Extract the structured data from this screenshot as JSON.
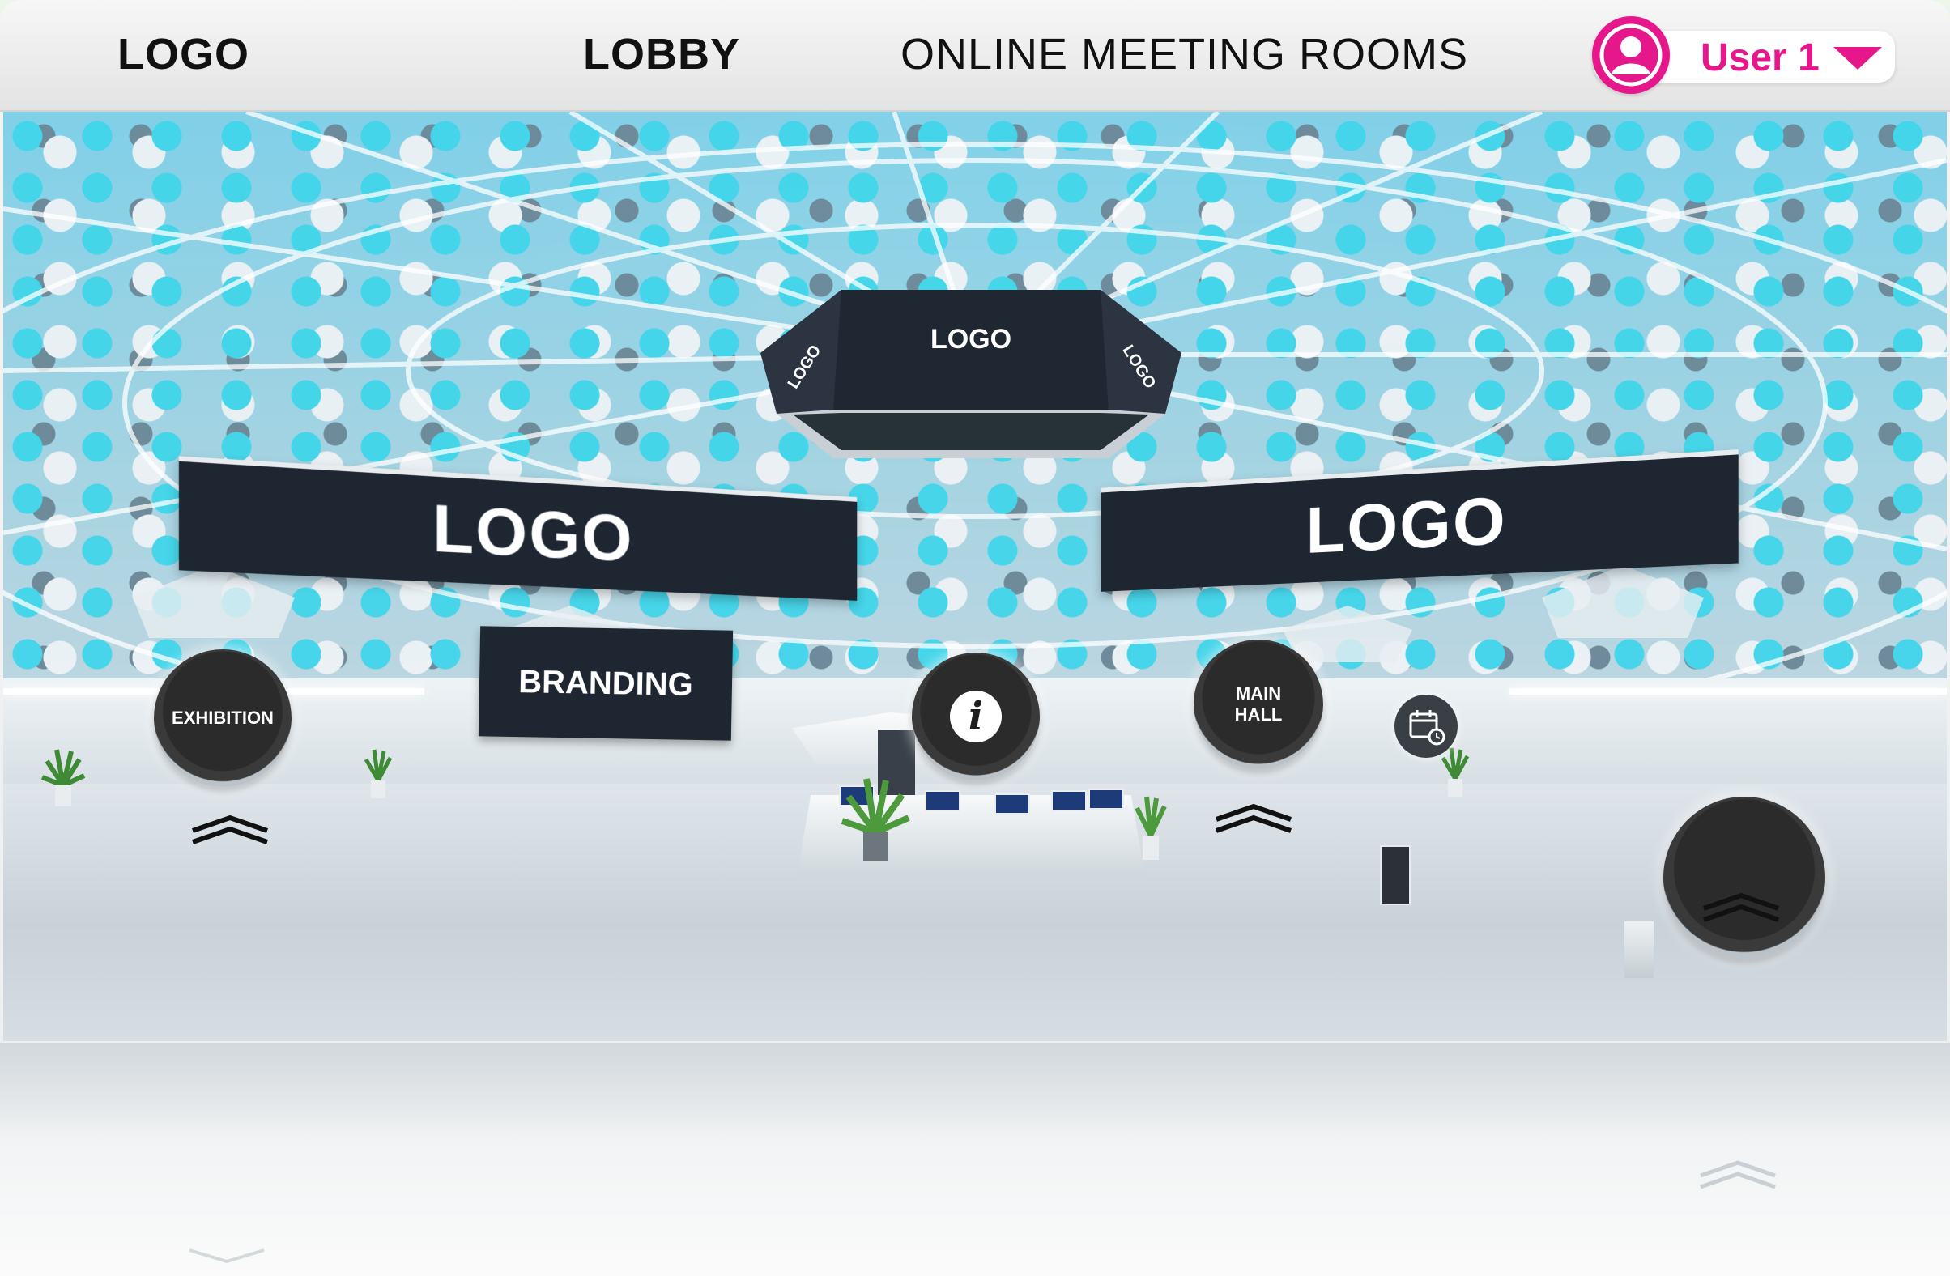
{
  "navbar": {
    "logo": "LOGO",
    "lobby_link": "LOBBY",
    "rooms_link": "ONLINE MEETING ROOMS",
    "user": {
      "name": "User 1",
      "avatar_icon": "user-avatar-icon",
      "dropdown_icon": "caret-down-icon"
    }
  },
  "scene": {
    "hex_sign": {
      "front": "LOGO",
      "left": "LOGO",
      "right": "LOGO"
    },
    "banner_left": "LOGO",
    "banner_right": "LOGO",
    "branding_board": "BRANDING",
    "hotspots": {
      "exhibition": "EXHIBITION",
      "info_icon": "info-icon",
      "main_hall_line1": "MAIN",
      "main_hall_line2": "HALL",
      "calendar_icon": "calendar-icon"
    }
  },
  "colors": {
    "accent": "#e6168b",
    "sign_panel": "#1e2631",
    "glass": "#3fd5ea"
  }
}
